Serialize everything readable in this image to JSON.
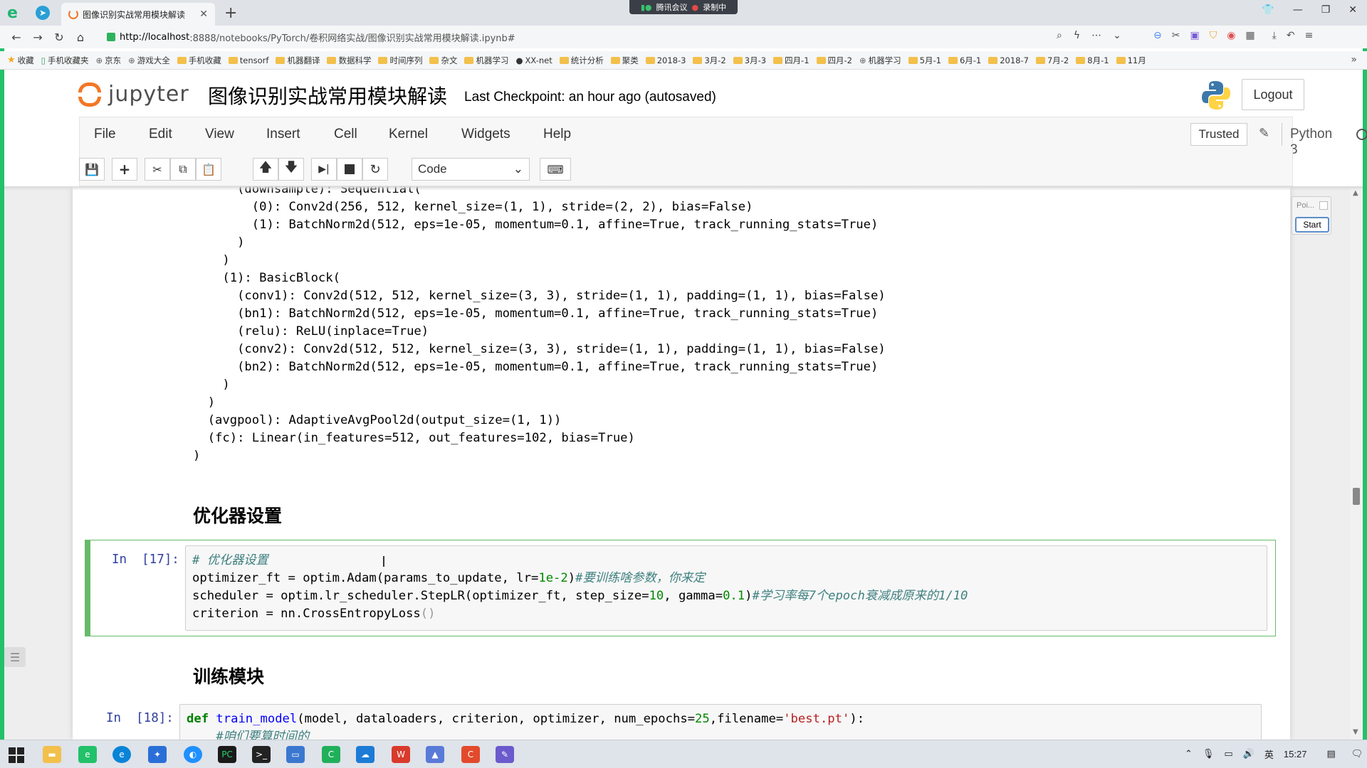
{
  "browser": {
    "tab_title": "图像识别实战常用模块解读",
    "new_tab": "+",
    "tab_close": "✕",
    "meeting": {
      "app": "腾讯会议",
      "status": "录制中"
    },
    "url_host": "http://localhost",
    "url_rest": ":8888/notebooks/PyTorch/卷积网络实战/图像识别实战常用模块解读.ipynb#",
    "bookmarks": [
      {
        "label": "收藏",
        "type": "star"
      },
      {
        "label": "手机收藏夹",
        "type": "phone"
      },
      {
        "label": "京东",
        "type": "globe"
      },
      {
        "label": "游戏大全",
        "type": "globe"
      },
      {
        "label": "手机收藏",
        "type": "folder"
      },
      {
        "label": "tensorf",
        "type": "folder"
      },
      {
        "label": "机器翻译",
        "type": "folder"
      },
      {
        "label": "数据科学",
        "type": "folder"
      },
      {
        "label": "时间序列",
        "type": "folder"
      },
      {
        "label": "杂文",
        "type": "folder"
      },
      {
        "label": "机器学习",
        "type": "folder"
      },
      {
        "label": "XX-net",
        "type": "github"
      },
      {
        "label": "统计分析",
        "type": "folder"
      },
      {
        "label": "聚类",
        "type": "folder"
      },
      {
        "label": "2018-3",
        "type": "folder"
      },
      {
        "label": "3月-2",
        "type": "folder"
      },
      {
        "label": "3月-3",
        "type": "folder"
      },
      {
        "label": "四月-1",
        "type": "folder"
      },
      {
        "label": "四月-2",
        "type": "folder"
      },
      {
        "label": "机器学习",
        "type": "globe"
      },
      {
        "label": "5月-1",
        "type": "folder"
      },
      {
        "label": "6月-1",
        "type": "folder"
      },
      {
        "label": "2018-7",
        "type": "folder"
      },
      {
        "label": "7月-2",
        "type": "folder"
      },
      {
        "label": "8月-1",
        "type": "folder"
      },
      {
        "label": "11月",
        "type": "folder"
      }
    ]
  },
  "jupyter": {
    "logo_text": "jupyter",
    "notebook_name": "图像识别实战常用模块解读",
    "checkpoint": "Last Checkpoint: an hour ago (autosaved)",
    "logout": "Logout",
    "menu": [
      "File",
      "Edit",
      "View",
      "Insert",
      "Cell",
      "Kernel",
      "Widgets",
      "Help"
    ],
    "trusted": "Trusted",
    "kernel": "Python 3",
    "cell_type": "Code"
  },
  "notebook": {
    "output_lines": [
      "      (downsample): Sequential(",
      "        (0): Conv2d(256, 512, kernel_size=(1, 1), stride=(2, 2), bias=False)",
      "        (1): BatchNorm2d(512, eps=1e-05, momentum=0.1, affine=True, track_running_stats=True)",
      "      )",
      "    )",
      "    (1): BasicBlock(",
      "      (conv1): Conv2d(512, 512, kernel_size=(3, 3), stride=(1, 1), padding=(1, 1), bias=False)",
      "      (bn1): BatchNorm2d(512, eps=1e-05, momentum=0.1, affine=True, track_running_stats=True)",
      "      (relu): ReLU(inplace=True)",
      "      (conv2): Conv2d(512, 512, kernel_size=(3, 3), stride=(1, 1), padding=(1, 1), bias=False)",
      "      (bn2): BatchNorm2d(512, eps=1e-05, momentum=0.1, affine=True, track_running_stats=True)",
      "    )",
      "  )",
      "  (avgpool): AdaptiveAvgPool2d(output_size=(1, 1))",
      "  (fc): Linear(in_features=512, out_features=102, bias=True)",
      ")"
    ],
    "heading_optimizer": "优化器设置",
    "cell17": {
      "prompt": "In  [17]:",
      "comment": "# 优化器设置",
      "line2_a": "optimizer_ft = optim.Adam(params_to_update, lr=",
      "line2_num": "1e-2",
      "line2_b": ")",
      "line2_cmt": "#要训练啥参数，你来定",
      "line3_a": "scheduler = optim.lr_scheduler.StepLR(optimizer_ft, step_size=",
      "line3_num1": "10",
      "line3_b": ", gamma=",
      "line3_num2": "0.1",
      "line3_c": ")",
      "line3_cmt": "#学习率每7个epoch衰减成原来的1/10",
      "line4_a": "criterion = nn.CrossEntropyLoss",
      "line4_par": "()"
    },
    "heading_train": "训练模块",
    "cell18": {
      "prompt": "In  [18]:",
      "kw": "def",
      "fn": "train_model",
      "args_a": "(model, dataloaders, criterion, optimizer, num_epochs=",
      "num": "25",
      "args_b": ",filename=",
      "str": "'best.pt'",
      "args_c": "):",
      "line2_cmt": "    #咱们要算时间的"
    }
  },
  "widget": {
    "label": "Poi...",
    "start": "Start"
  },
  "taskbar": {
    "clock": "15:27",
    "ime": "英"
  },
  "colors": {
    "jupyter_orange": "#f37726",
    "selected_cell": "#66bb6a",
    "prompt_blue": "#303f9f",
    "browser_green": "#22c16a"
  }
}
